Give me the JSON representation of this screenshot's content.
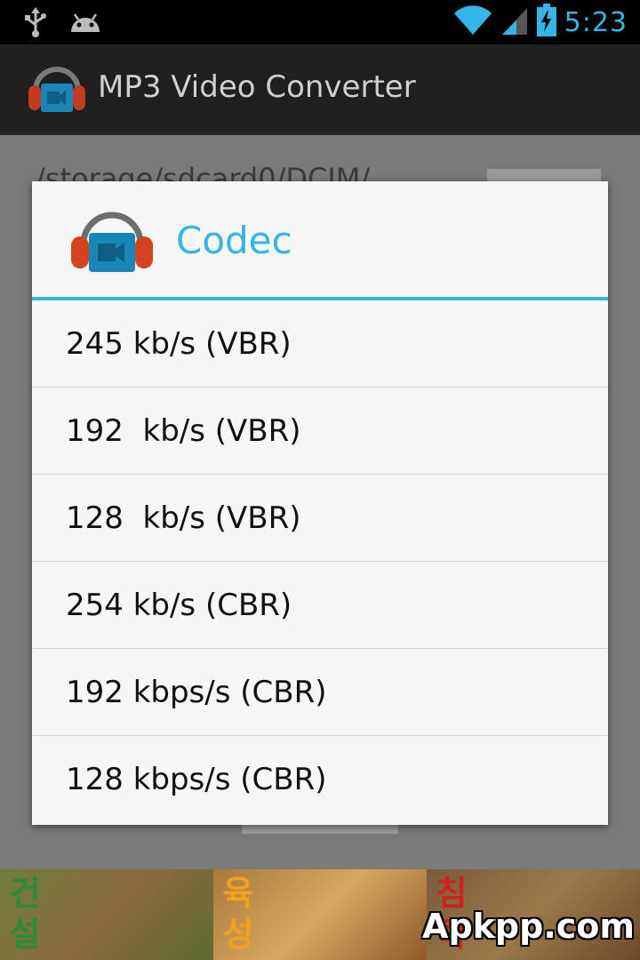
{
  "status_bar": {
    "left_icons": [
      "usb-icon",
      "android-icon"
    ],
    "right_icons": [
      "wifi-icon",
      "signal-icon",
      "battery-charging-icon"
    ],
    "time": "5:23"
  },
  "action_bar": {
    "app_icon": "headphones-camera-icon",
    "title": "MP3 Video Converter"
  },
  "background": {
    "path_text": "/storage/sdcard0/DCIM/"
  },
  "dialog": {
    "icon": "headphones-camera-icon",
    "title": "Codec",
    "options": [
      "245 kb/s (VBR)",
      "192  kb/s (VBR)",
      "128  kb/s (VBR)",
      "254 kb/s (CBR)",
      "192 kbps/s (CBR)",
      "128 kbps/s (CBR)"
    ]
  },
  "ad_banner": {
    "panels": [
      "건설",
      "육성",
      "침략"
    ]
  },
  "watermark": "Apkpp.com",
  "colors": {
    "accent": "#33b5e5",
    "action_bar_bg": "#1f1f1f",
    "dialog_bg": "#f7f7f7",
    "dim_bg": "#7a7a7a"
  }
}
